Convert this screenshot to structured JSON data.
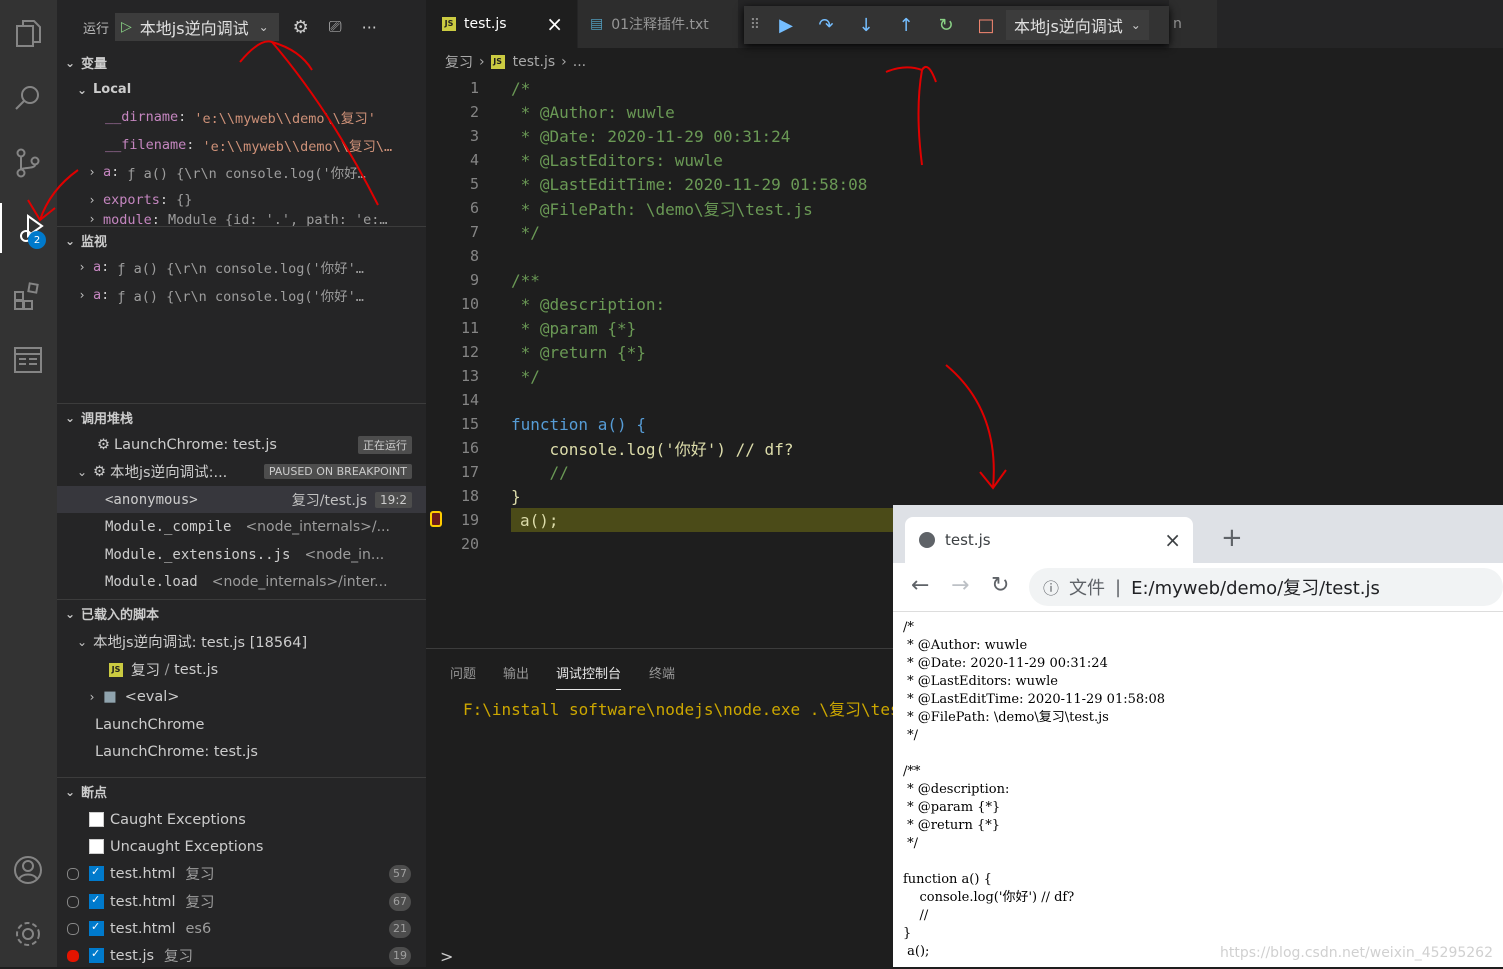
{
  "activity": {
    "badge": "2"
  },
  "run": {
    "label": "运行",
    "config": "本地js逆向调试"
  },
  "sections": {
    "variables": "变量",
    "local": "Local",
    "watch": "监视",
    "callstack": "调用堆栈",
    "loaded_scripts": "已载入的脚本",
    "breakpoints": "断点"
  },
  "variables": [
    {
      "name": "__dirname",
      "value": "'e:\\\\myweb\\\\demo\\\\复习'"
    },
    {
      "name": "__filename",
      "value": "'e:\\\\myweb\\\\demo\\\\复习\\…"
    },
    {
      "name": "a",
      "value": "ƒ a() {\\r\\n    console.log('你好…"
    },
    {
      "name": "exports",
      "value": "{}"
    },
    {
      "name": "module",
      "value": "Module {id: '.', path: 'e:…"
    }
  ],
  "watch": [
    {
      "name": "a",
      "value": "ƒ a() {\\r\\n    console.log('你好'…"
    },
    {
      "name": "a",
      "value": "ƒ a() {\\r\\n    console.log('你好'…"
    }
  ],
  "callstack": {
    "sessions": [
      {
        "name": "LaunchChrome: test.js",
        "status": "正在运行"
      },
      {
        "name": "本地js逆向调试:...",
        "status": "PAUSED ON BREAKPOINT"
      }
    ],
    "frames": [
      {
        "name": "<anonymous>",
        "source": "复习/test.js",
        "pos": "19:2"
      },
      {
        "name": "Module._compile",
        "source": "<node_internals>/..."
      },
      {
        "name": "Module._extensions..js",
        "source": "<node_in..."
      },
      {
        "name": "Module.load",
        "source": "<node_internals>/inter..."
      }
    ]
  },
  "loaded": {
    "session": "本地js逆向调试: test.js [18564]",
    "file_dir": "复习",
    "file_name": "test.js",
    "eval": "<eval>",
    "chrome1": "LaunchChrome",
    "chrome2": "LaunchChrome: test.js"
  },
  "breakpoints": {
    "caught": "Caught Exceptions",
    "uncaught": "Uncaught Exceptions",
    "items": [
      {
        "file": "test.html",
        "dir": "复习",
        "line": "57"
      },
      {
        "file": "test.html",
        "dir": "复习",
        "line": "67"
      },
      {
        "file": "test.html",
        "dir": "es6",
        "line": "21"
      },
      {
        "file": "test.js",
        "dir": "复习",
        "line": "19"
      }
    ]
  },
  "tabs": [
    {
      "label": "test.js",
      "close": "×"
    },
    {
      "label": "01注释插件.txt"
    },
    {
      "label": "n"
    }
  ],
  "debug_toolbar": {
    "config": "本地js逆向调试"
  },
  "breadcrumb": {
    "folder": "复习",
    "file": "test.js",
    "more": "..."
  },
  "editor": {
    "lines": [
      "/*",
      " * @Author: wuwle",
      " * @Date: 2020-11-29 00:31:24",
      " * @LastEditors: wuwle",
      " * @LastEditTime: 2020-11-29 01:58:08",
      " * @FilePath: \\demo\\复习\\test.js",
      " */",
      "",
      "/**",
      " * @description:",
      " * @param {*}",
      " * @return {*}",
      " */",
      "",
      "function a() {",
      "    console.log('你好') // df?",
      "    //",
      "}",
      "a();",
      ""
    ],
    "current_line": 19
  },
  "panel": {
    "tabs": [
      "问题",
      "输出",
      "调试控制台",
      "终端"
    ],
    "active": "调试控制台",
    "output": "F:\\install software\\nodejs\\node.exe .\\复习\\test.js",
    "prompt": ">"
  },
  "browser": {
    "tab_title": "test.js",
    "close": "×",
    "new_tab": "+",
    "url_label": "文件",
    "url": "E:/myweb/demo/复习/test.js",
    "content": "/*\n * @Author: wuwle\n * @Date: 2020-11-29 00:31:24\n * @LastEditors: wuwle\n * @LastEditTime: 2020-11-29 01:58:08\n * @FilePath: \\demo\\复习\\test.js\n */\n\n/**\n * @description:\n * @param {*}\n * @return {*}\n */\n\nfunction a() {\n    console.log('你好') // df?\n    //\n}\n a();"
  },
  "watermark": "https://blog.csdn.net/weixin_45295262"
}
